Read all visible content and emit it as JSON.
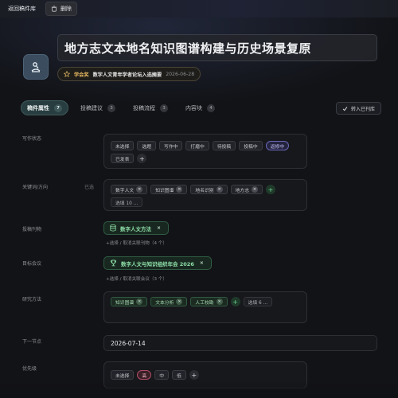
{
  "topbar": {
    "back_label": "返回稿件库",
    "delete_label": "删除"
  },
  "header": {
    "title": "地方志文本地名知识图谱构建与历史场景复原",
    "award_type": "学会奖",
    "award_name": "数字人文青年学者论坛入选摘要",
    "award_date": "2026-06-28"
  },
  "tabs": [
    {
      "label": "稿件属性",
      "count": "7",
      "active": true
    },
    {
      "label": "投稿建议",
      "count": "3",
      "active": false
    },
    {
      "label": "投稿流程",
      "count": "3",
      "active": false
    },
    {
      "label": "内容块",
      "count": "4",
      "active": false
    }
  ],
  "move_button_label": "转入已刊库",
  "fields": {
    "status": {
      "label": "写作状态",
      "options": [
        "未选择",
        "选题",
        "写作中",
        "打磨中",
        "待投稿",
        "投稿中",
        "返修中",
        "已发表"
      ],
      "selected": "返修中"
    },
    "keywords": {
      "label": "关键词/方向",
      "aux_label": "已选",
      "items": [
        "数字人文",
        "知识图谱",
        "地名识别",
        "地方志"
      ],
      "more": "选填 10 ..."
    },
    "journal": {
      "label": "投稿刊物",
      "value": "数字人文方法",
      "hint": "+选择 / 取消关联刊物（4 个）"
    },
    "conference": {
      "label": "目标会议",
      "value": "数字人文与知识组织年会 2026",
      "hint": "+选择 / 取消关联会议（3 个）"
    },
    "methods": {
      "label": "研究方法",
      "items": [
        "知识图谱",
        "文本分析",
        "人工校勘"
      ],
      "more": "选填 6 ..."
    },
    "next_node": {
      "label": "下一节点",
      "value": "2026-07-14"
    },
    "priority": {
      "label": "优先级",
      "options": [
        "未选择",
        "高",
        "中",
        "低"
      ],
      "selected": "高"
    }
  },
  "colors": {
    "background": "#121317",
    "accent_green": "#8fe0a8",
    "accent_purple": "#c7c4ff",
    "accent_red": "#f2b6c2",
    "award_gold": "#e4b760"
  }
}
